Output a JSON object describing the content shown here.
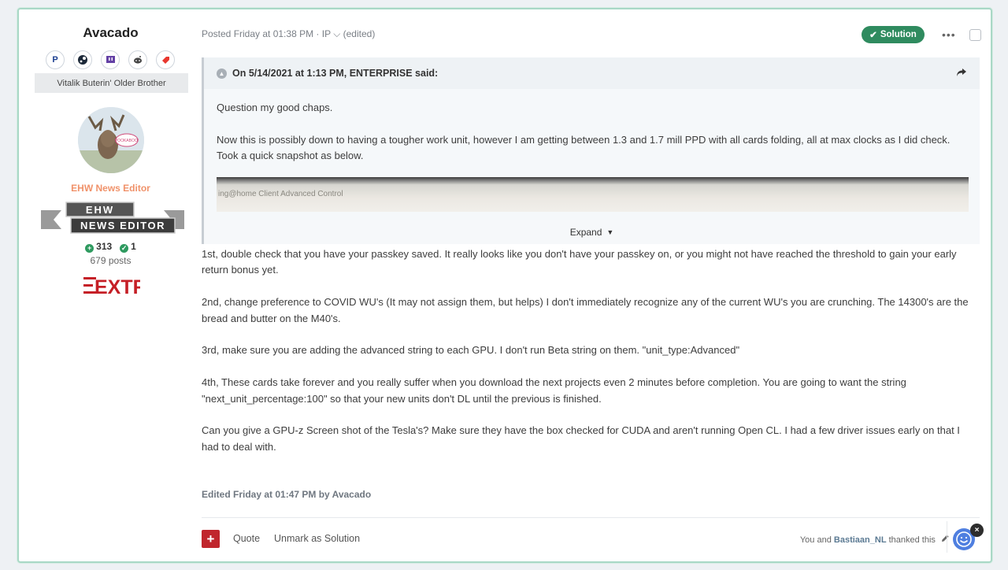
{
  "author": {
    "name": "Avacado",
    "social": [
      "paypal-icon",
      "steam-icon",
      "twitch-icon",
      "reddit-icon",
      "tag-icon"
    ],
    "group_title": "Vitalik Buterin' Older Brother",
    "avatar_caption": "POOKABOO!",
    "user_title": "EHW News Editor",
    "badge_line1": "EHW",
    "badge_line2": "NEWS EDITOR",
    "reputation": "313",
    "solutions": "1",
    "posts": "679 posts",
    "extr_logo": "EXTR"
  },
  "post": {
    "meta": "Posted Friday at 01:38 PM · IP ⌵ (edited)",
    "solution_label": "Solution",
    "quote": {
      "header": "On 5/14/2021 at 1:13 PM, ENTERPRISE said:",
      "paragraphs": [
        "Question my good chaps.",
        "Now this is possibly down to having a tougher work unit, however I am getting between 1.3 and 1.7 mill PPD with all cards folding, all at max clocks as I did check. Took a quick snapshot as below."
      ],
      "snapshot_text": "ing@home Client Advanced Control",
      "expand_label": "Expand"
    },
    "paragraphs": [
      "1st, double check that you have your passkey saved. It really looks like you don't have your passkey on, or you might not have reached the threshold to gain your early return bonus yet.",
      "2nd, change preference to COVID WU's (It may not assign them, but helps) I don't immediately recognize any of the current WU's you are crunching. The 14300's are the bread and butter on the M40's.",
      "3rd, make sure you are adding the advanced string to each GPU. I don't run Beta string on them. \"unit_type:Advanced\"",
      "4th, These cards take forever and you really suffer when you download the next projects even 2 minutes before completion. You are going to want the string \"next_unit_percentage:100\" so that your new units don't DL until the previous is finished.",
      "Can you give a GPU-z Screen shot of the Tesla's? Make sure they have the box checked for CUDA and aren't running Open CL. I had a few driver issues early on that I had to deal with."
    ],
    "edited": "Edited Friday at 01:47 PM by Avacado"
  },
  "footer": {
    "plus_label": "+",
    "quote_label": "Quote",
    "unmark_label": "Unmark as Solution",
    "thanks_prefix": "You and",
    "thanks_user": "Bastiaan_NL",
    "thanks_suffix": "thanked this"
  },
  "colors": {
    "solution": "#2f8b5f",
    "user_title": "#f0926a",
    "plus_button": "#c0262d",
    "reaction": "#4f7fe0"
  }
}
